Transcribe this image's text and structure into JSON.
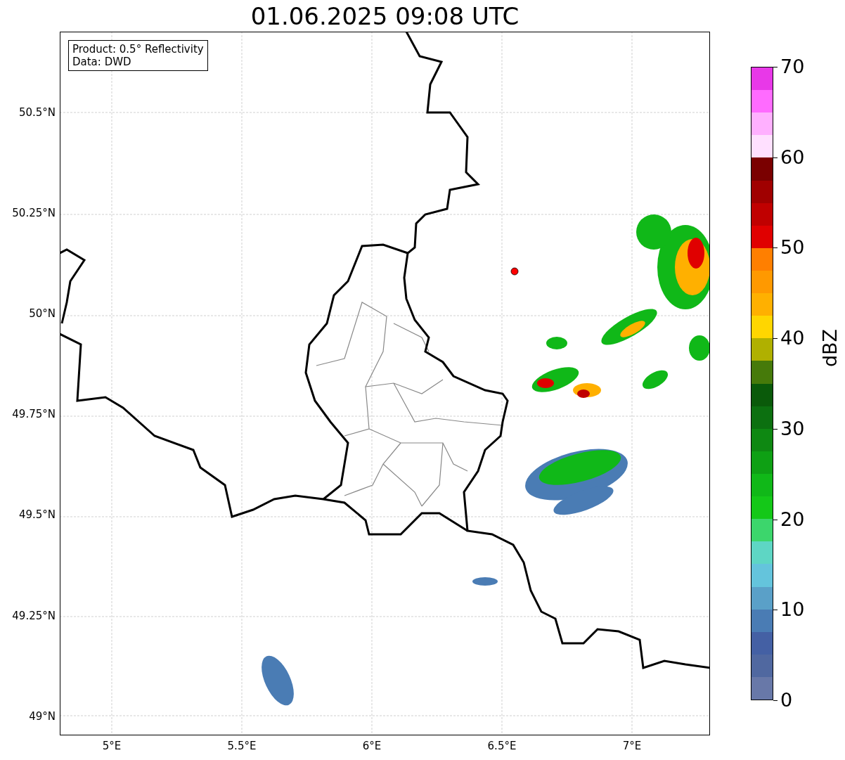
{
  "title": "01.06.2025 09:08 UTC",
  "info_box": {
    "lines": [
      "Product: 0.5° Reflectivity",
      "Data: DWD"
    ]
  },
  "map": {
    "xticks": [
      "5°E",
      "5.5°E",
      "6°E",
      "6.5°E",
      "7°E"
    ],
    "yticks": [
      "50.5°N",
      "50.25°N",
      "50°N",
      "49.75°N",
      "49.5°N",
      "49.25°N",
      "49°N"
    ]
  },
  "colorbar": {
    "label": "dBZ",
    "ticks": [
      "70",
      "60",
      "50",
      "40",
      "30",
      "20",
      "10",
      "0"
    ],
    "bands": [
      {
        "color": "#e838e8"
      },
      {
        "color": "#ff6bff"
      },
      {
        "color": "#ffb0ff"
      },
      {
        "color": "#ffe0ff"
      },
      {
        "color": "#7a0000"
      },
      {
        "color": "#a00000"
      },
      {
        "color": "#c00000"
      },
      {
        "color": "#e00000"
      },
      {
        "color": "#ff7f00"
      },
      {
        "color": "#ff9900"
      },
      {
        "color": "#ffb000"
      },
      {
        "color": "#ffd600"
      },
      {
        "color": "#b0b000"
      },
      {
        "color": "#467a0a"
      },
      {
        "color": "#0a5a0a"
      },
      {
        "color": "#0c7010"
      },
      {
        "color": "#0e8812"
      },
      {
        "color": "#0ea014"
      },
      {
        "color": "#10b818"
      },
      {
        "color": "#14c818"
      },
      {
        "color": "#3cd66c"
      },
      {
        "color": "#5ed6c4"
      },
      {
        "color": "#64c4dc"
      },
      {
        "color": "#5aa0c8"
      },
      {
        "color": "#4a7cb4"
      },
      {
        "color": "#4460a4"
      },
      {
        "color": "#5068a0"
      },
      {
        "color": "#6878a8"
      }
    ]
  }
}
